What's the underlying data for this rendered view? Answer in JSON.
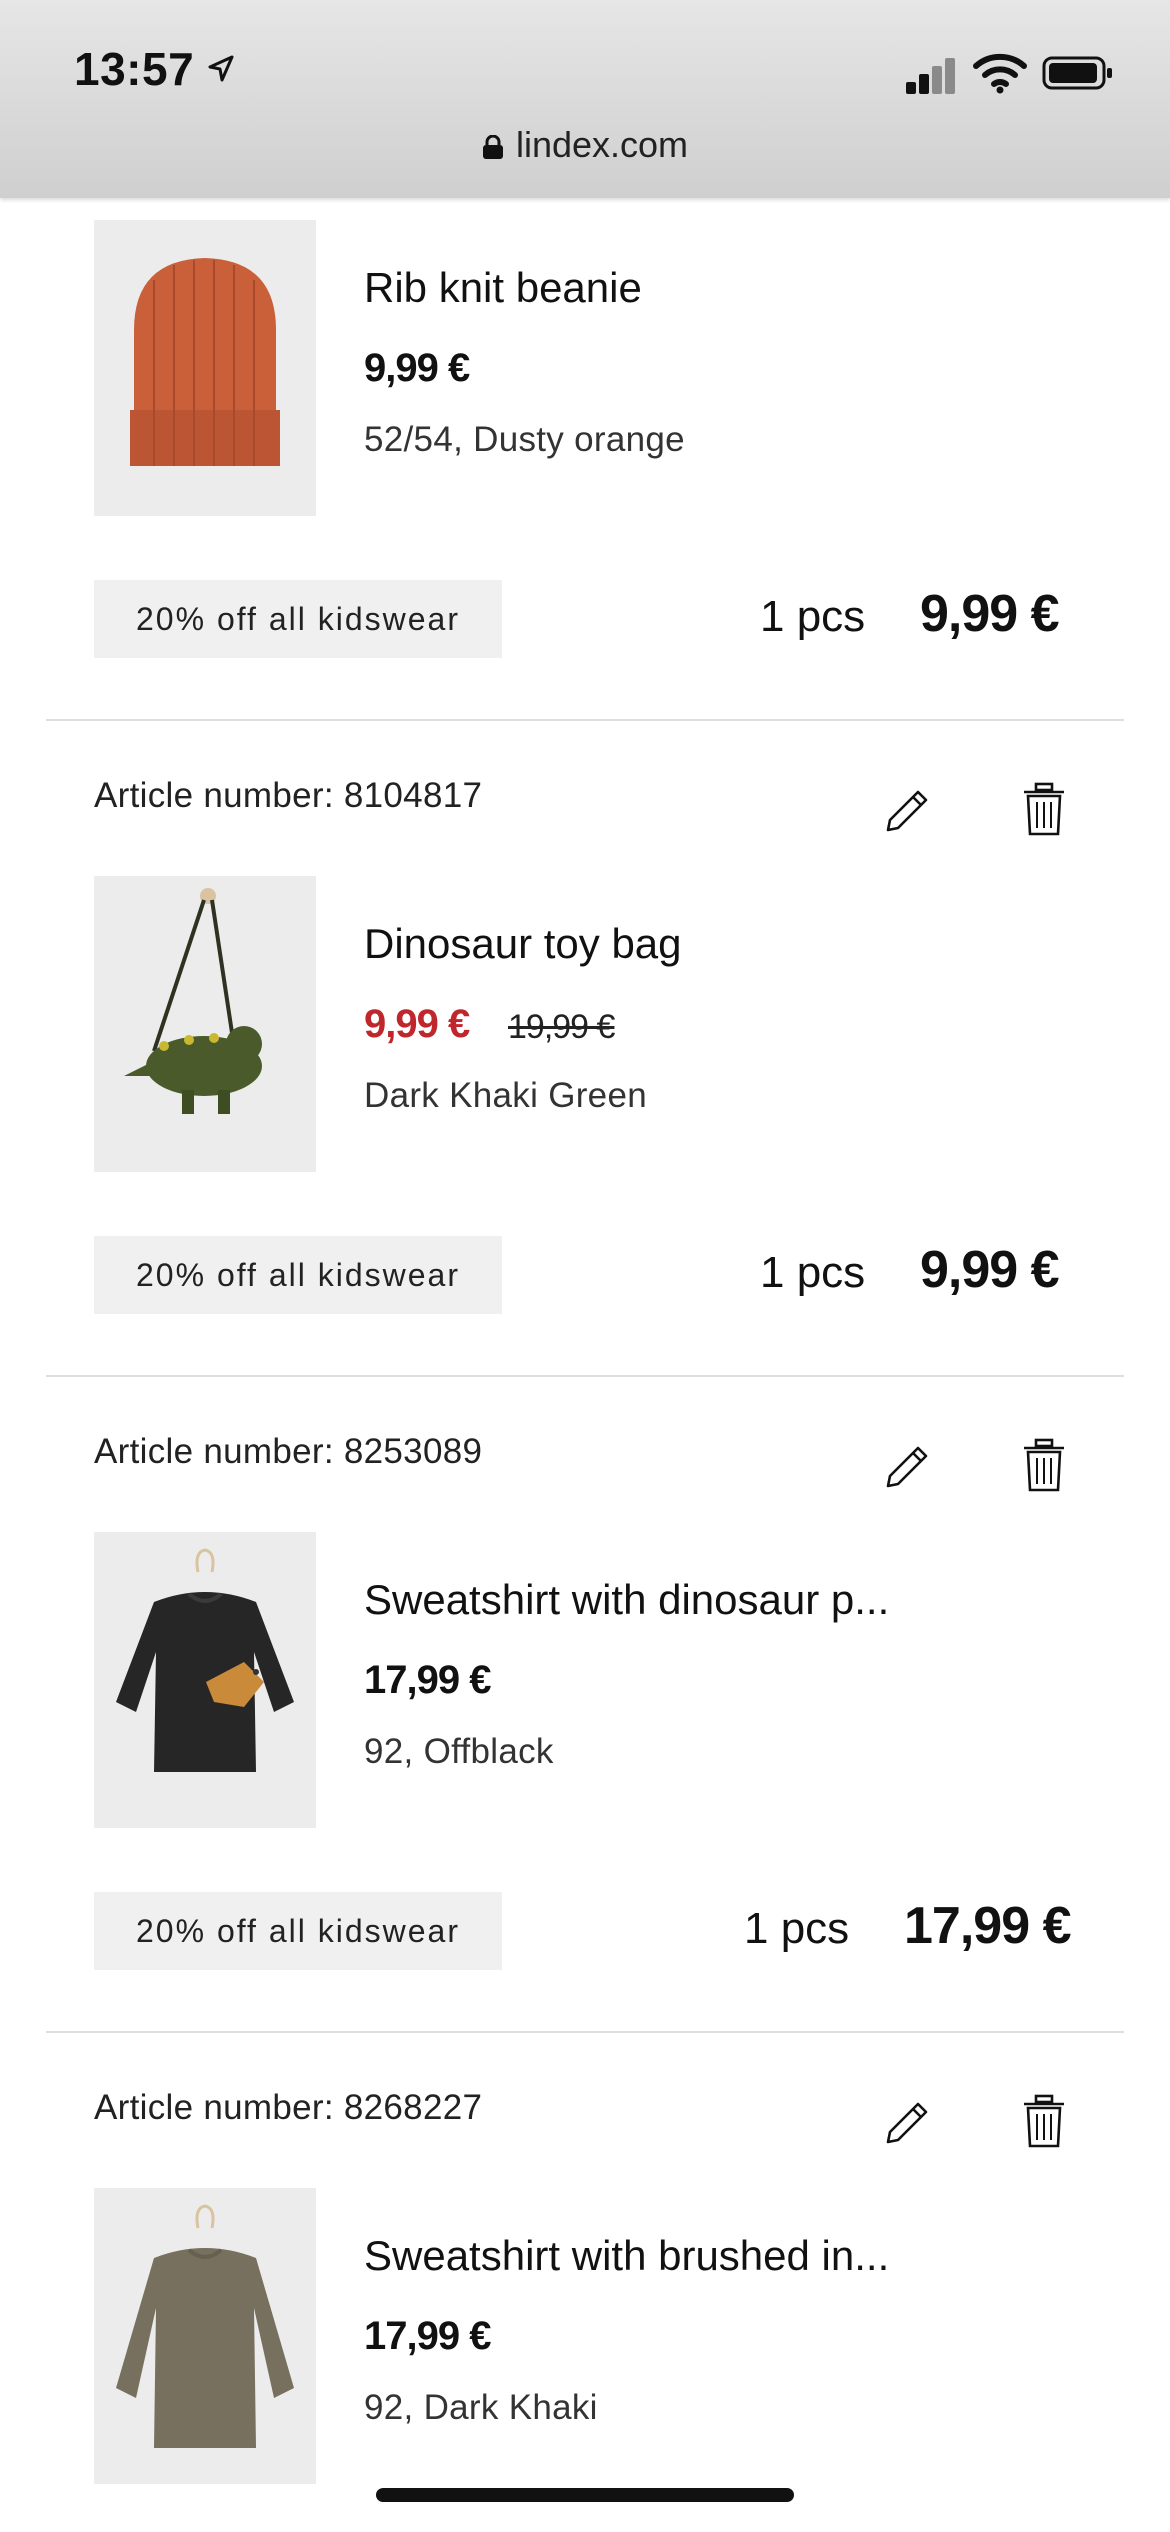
{
  "status_bar": {
    "time": "13:57",
    "url": "lindex.com"
  },
  "cart_items": [
    {
      "article_label": "",
      "name": "Rib knit beanie",
      "price": "9,99 €",
      "old_price": "",
      "variant": "52/54, Dusty orange",
      "promo": "20% off all kidswear",
      "quantity": "1 pcs",
      "total": "9,99 €",
      "image": "orange-beanie"
    },
    {
      "article_label": "Article number: 8104817",
      "name": "Dinosaur toy bag",
      "price": "9,99 €",
      "old_price": "19,99 €",
      "variant": "Dark Khaki Green",
      "promo": "20% off all kidswear",
      "quantity": "1 pcs",
      "total": "9,99 €",
      "image": "dinosaur-bag"
    },
    {
      "article_label": "Article number: 8253089",
      "name": "Sweatshirt with dinosaur p...",
      "price": "17,99 €",
      "old_price": "",
      "variant": "92, Offblack",
      "promo": "20% off all kidswear",
      "quantity": "1 pcs",
      "total": "17,99 €",
      "image": "black-dinosaur-sweatshirt"
    },
    {
      "article_label": "Article number: 8268227",
      "name": "Sweatshirt with brushed in...",
      "price": "17,99 €",
      "old_price": "",
      "variant": "92, Dark Khaki",
      "promo": "",
      "quantity": "",
      "total": "",
      "image": "khaki-sweatshirt"
    }
  ],
  "colors": {
    "sale_price": "#c0272d",
    "promo_bg": "#f0f0f0",
    "divider": "#dedede"
  }
}
